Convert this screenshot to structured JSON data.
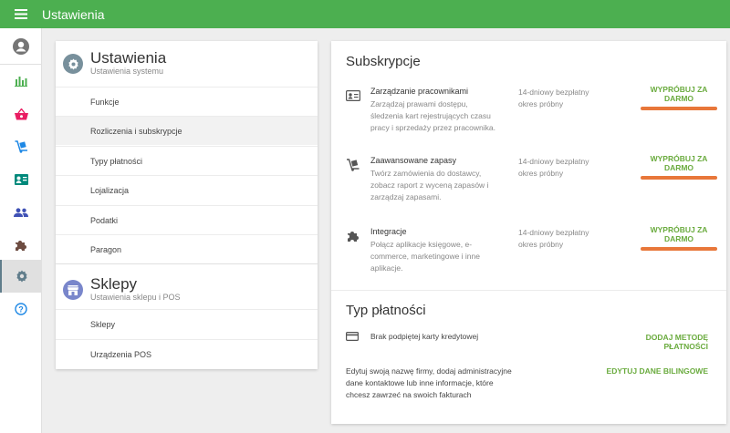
{
  "header": {
    "title": "Ustawienia",
    "menu_icon": "hamburger-icon",
    "color": "#4caf50"
  },
  "rail": {
    "items": [
      {
        "icon": "account-icon",
        "color": "#757575"
      },
      {
        "icon": "bar-chart-icon",
        "color": "#4caf50"
      },
      {
        "icon": "basket-icon",
        "color": "#e91e63"
      },
      {
        "icon": "dolly-icon",
        "color": "#1e88e5"
      },
      {
        "icon": "contact-card-icon",
        "color": "#00897b"
      },
      {
        "icon": "people-icon",
        "color": "#3f51b5"
      },
      {
        "icon": "puzzle-icon",
        "color": "#6d4c41"
      },
      {
        "icon": "gear-icon",
        "color": "#607d8b",
        "active": true
      },
      {
        "icon": "help-icon",
        "color": "#1e88e5"
      }
    ]
  },
  "settings": {
    "title": "Ustawienia",
    "subtitle": "Ustawienia systemu",
    "icon_color": "#78909c",
    "items": [
      {
        "label": "Funkcje"
      },
      {
        "label": "Rozliczenia i subskrypcje",
        "selected": true
      },
      {
        "label": "Typy płatności"
      },
      {
        "label": "Lojalizacja"
      },
      {
        "label": "Podatki"
      },
      {
        "label": "Paragon"
      }
    ]
  },
  "stores": {
    "title": "Sklepy",
    "subtitle": "Ustawienia sklepu i POS",
    "icon_color": "#7986cb",
    "items": [
      {
        "label": "Sklepy"
      },
      {
        "label": "Urządzenia POS"
      }
    ]
  },
  "subscriptions": {
    "title": "Subskrypcje",
    "accent": "#6aab3e",
    "highlight": "#e8773a",
    "items": [
      {
        "icon": "contact-card-icon",
        "name": "Zarządzanie pracownikami",
        "description": "Zarządzaj prawami dostępu, śledzenia kart rejestrujących czasu pracy i sprzedaży przez pracownika.",
        "trial": "14-dniowy bezpłatny okres próbny",
        "action": "WYPRÓBUJ ZA DARMO"
      },
      {
        "icon": "dolly-icon",
        "name": "Zaawansowane zapasy",
        "description": "Twórz zamówienia do dostawcy, zobacz raport z wyceną zapasów i zarządzaj zapasami.",
        "trial": "14-dniowy bezpłatny okres próbny",
        "action": "WYPRÓBUJ ZA DARMO"
      },
      {
        "icon": "puzzle-icon",
        "name": "Integracje",
        "description": "Połącz aplikacje księgowe, e-commerce, marketingowe i inne aplikacje.",
        "trial": "14-dniowy bezpłatny okres próbny",
        "action": "WYPRÓBUJ ZA DARMO"
      }
    ]
  },
  "payment": {
    "title": "Typ płatności",
    "card_icon": "credit-card-icon",
    "card_text": "Brak podpiętej karty kredytowej",
    "card_action": "DODAJ METODĘ PŁATNOŚCI",
    "billing_text": "Edytuj swoją nazwę firmy, dodaj administracyjne dane kontaktowe lub inne informacje, które chcesz zawrzeć na swoich fakturach",
    "billing_action": "EDYTUJ DANE BILINGOWE"
  }
}
